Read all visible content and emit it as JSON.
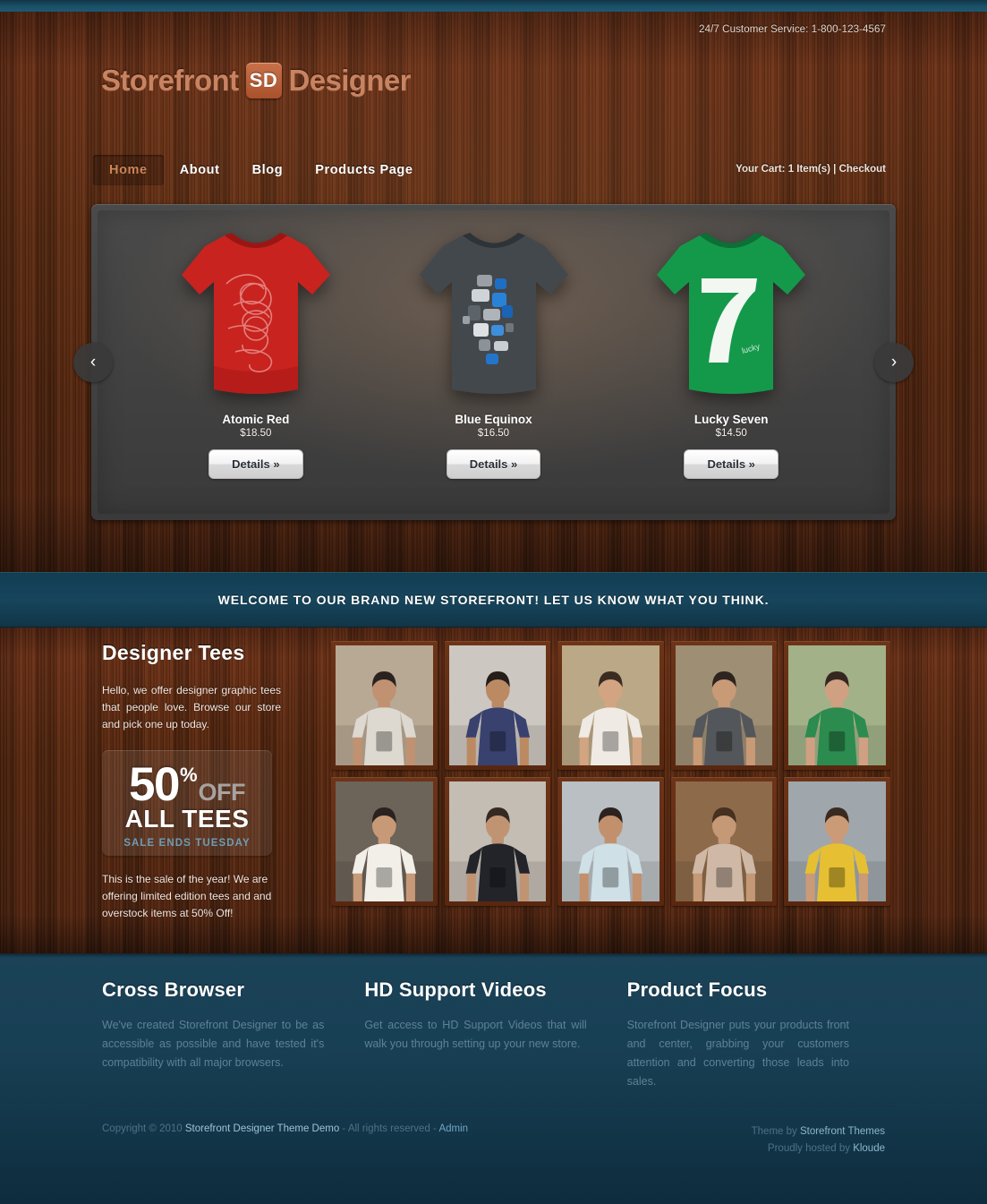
{
  "header": {
    "service_text": "24/7 Customer Service: 1-800-123-4567",
    "logo_left": "Storefront",
    "logo_badge": "SD",
    "logo_right": "Designer",
    "cart_text": "Your Cart: 1 Item(s) | Checkout"
  },
  "nav": {
    "items": [
      {
        "label": "Home",
        "active": true
      },
      {
        "label": "About",
        "active": false
      },
      {
        "label": "Blog",
        "active": false
      },
      {
        "label": "Products Page",
        "active": false
      }
    ]
  },
  "carousel": {
    "prev_icon": "‹",
    "next_icon": "›",
    "details_label": "Details »",
    "slides": [
      {
        "name": "Atomic Red",
        "price": "$18.50",
        "color": "#c8231f",
        "shade": "#9c1512",
        "art": "scribble"
      },
      {
        "name": "Blue Equinox",
        "price": "$16.50",
        "color": "#43484d",
        "shade": "#2e3337",
        "art": "blocks"
      },
      {
        "name": "Lucky Seven",
        "price": "$14.50",
        "color": "#14994a",
        "shade": "#0c6f35",
        "art": "seven"
      }
    ]
  },
  "welcome": {
    "text": "WELCOME TO OUR BRAND NEW STOREFRONT! LET US KNOW WHAT YOU THINK."
  },
  "designer_tees": {
    "title": "Designer Tees",
    "intro": "Hello, we offer designer graphic tees that people love. Browse our store and pick one up today.",
    "sale": {
      "percent": "50",
      "percent_symbol": "%",
      "off": "OFF",
      "all_tees": "ALL TEES",
      "ends": "SALE ENDS TUESDAY"
    },
    "footer_text": "This is the sale of the year! We are offering limited edition tees and and overstock items at 50% Off!"
  },
  "gallery": {
    "photos": [
      {
        "alt": "man in shop with grey printed tee",
        "bg": "#b8a994",
        "shirt": "#ddd8d0",
        "skin": "#c09272",
        "hair": "#2b2220"
      },
      {
        "alt": "man in navy bird tee",
        "bg": "#ccc7c0",
        "shirt": "#39416e",
        "skin": "#bb8a63",
        "hair": "#241d1a"
      },
      {
        "alt": "man in white butterfly tee",
        "bg": "#bba886",
        "shirt": "#efeae4",
        "skin": "#d3a481",
        "hair": "#3b2c22"
      },
      {
        "alt": "man with skateboard in grey tee",
        "bg": "#9e8e74",
        "shirt": "#53565a",
        "skin": "#c89a76",
        "hair": "#2d2420"
      },
      {
        "alt": "man in green tree tee",
        "bg": "#a3b189",
        "shirt": "#2c8b4e",
        "skin": "#cfa081",
        "hair": "#33271f"
      },
      {
        "alt": "man in white exclamation tee",
        "bg": "#6c6359",
        "shirt": "#f2efe9",
        "skin": "#c79976",
        "hair": "#2a2220"
      },
      {
        "alt": "man in black leaf tee in alley",
        "bg": "#c3bdb4",
        "shirt": "#23242a",
        "skin": "#c09472",
        "hair": "#352a23"
      },
      {
        "alt": "man in light blue tee by brick wall",
        "bg": "#b9bfc2",
        "shirt": "#cfe0e6",
        "skin": "#c2906c",
        "hair": "#2c231e"
      },
      {
        "alt": "bearded man in triangle tee",
        "bg": "#8d6a4a",
        "shirt": "#cfb9a6",
        "skin": "#c59876",
        "hair": "#46301f"
      },
      {
        "alt": "man in yellow graphic tee",
        "bg": "#9fa7ad",
        "shirt": "#e6c032",
        "skin": "#cb9b77",
        "hair": "#3a2b22"
      }
    ]
  },
  "features": [
    {
      "title": "Cross Browser",
      "body": "We've created Storefront Designer to be as accessible as possible and have tested it's compatibility with all major browsers."
    },
    {
      "title": "HD Support Videos",
      "body": "Get access to HD Support Videos that will walk you through setting up your new store."
    },
    {
      "title": "Product Focus",
      "body": "Storefront Designer puts your products front and center, grabbing your customers attention and converting those leads into sales."
    }
  ],
  "footer": {
    "copyright_pre": "Copyright © 2010 ",
    "copyright_brand": "Storefront Designer Theme Demo",
    "copyright_mid": " - All rights reserved - ",
    "admin_link": "Admin",
    "theme_pre": "Theme by ",
    "theme_link": "Storefront Themes",
    "host_pre": "Proudly hosted by ",
    "host_link": "Kloude"
  }
}
